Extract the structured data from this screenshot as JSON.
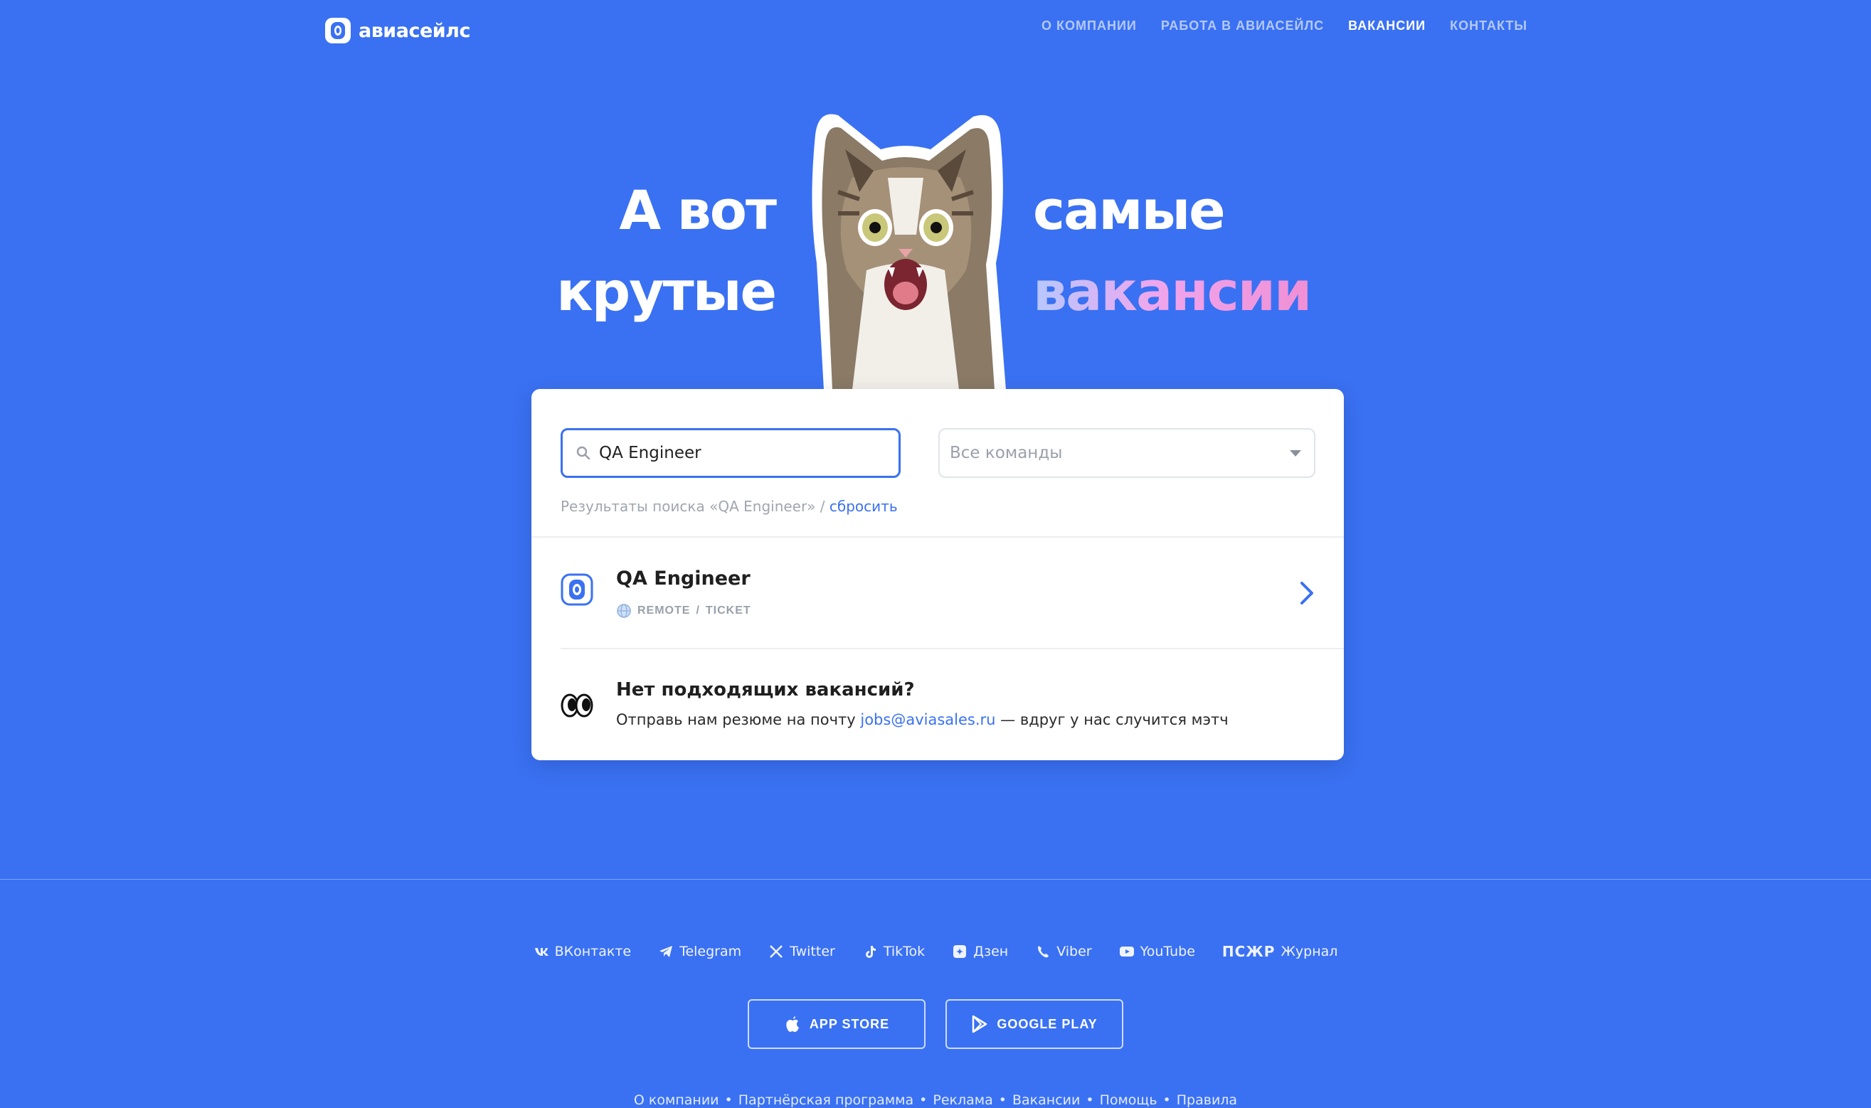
{
  "brand": {
    "name": "авиасейлс"
  },
  "nav": {
    "items": [
      {
        "label": "О КОМПАНИИ"
      },
      {
        "label": "РАБОТА В АВИАСЕЙЛС"
      },
      {
        "label": "ВАКАНСИИ",
        "active": true
      },
      {
        "label": "КОНТАКТЫ"
      }
    ]
  },
  "hero": {
    "left_line1": "А вот",
    "left_line2": "крутые",
    "right_line1": "самые",
    "right_line2": "вакансии"
  },
  "search": {
    "value": "QA Engineer",
    "team_select": "Все команды",
    "results_prefix": "Результаты поиска «QA Engineer» /",
    "reset_label": "сбросить"
  },
  "jobs": [
    {
      "title": "QA Engineer",
      "location": "REMOTE",
      "separator": "/",
      "team": "TICKET"
    }
  ],
  "no_match": {
    "title": "Нет подходящих вакансий?",
    "text_before": "Отправь нам резюме на почту",
    "email": "jobs@aviasales.ru",
    "text_after": "— вдруг у нас случится мэтч"
  },
  "footer": {
    "socials": [
      {
        "label": "ВКонтакте",
        "icon": "vk-icon"
      },
      {
        "label": "Telegram",
        "icon": "telegram-icon"
      },
      {
        "label": "Twitter",
        "icon": "x-icon"
      },
      {
        "label": "TikTok",
        "icon": "tiktok-icon"
      },
      {
        "label": "Дзен",
        "icon": "dzen-icon"
      },
      {
        "label": "Viber",
        "icon": "viber-icon"
      },
      {
        "label": "YouTube",
        "icon": "youtube-icon"
      },
      {
        "label": "Журнал",
        "icon_text": "ПСЖР"
      }
    ],
    "stores": {
      "app_store": "APP STORE",
      "google_play": "GOOGLE PLAY"
    },
    "links": [
      "О компании",
      "Партнёрская программа",
      "Реклама",
      "Вакансии",
      "Помощь",
      "Правила"
    ]
  },
  "colors": {
    "background": "#3a71f2",
    "accent": "#3a71f2",
    "card": "#ffffff"
  }
}
